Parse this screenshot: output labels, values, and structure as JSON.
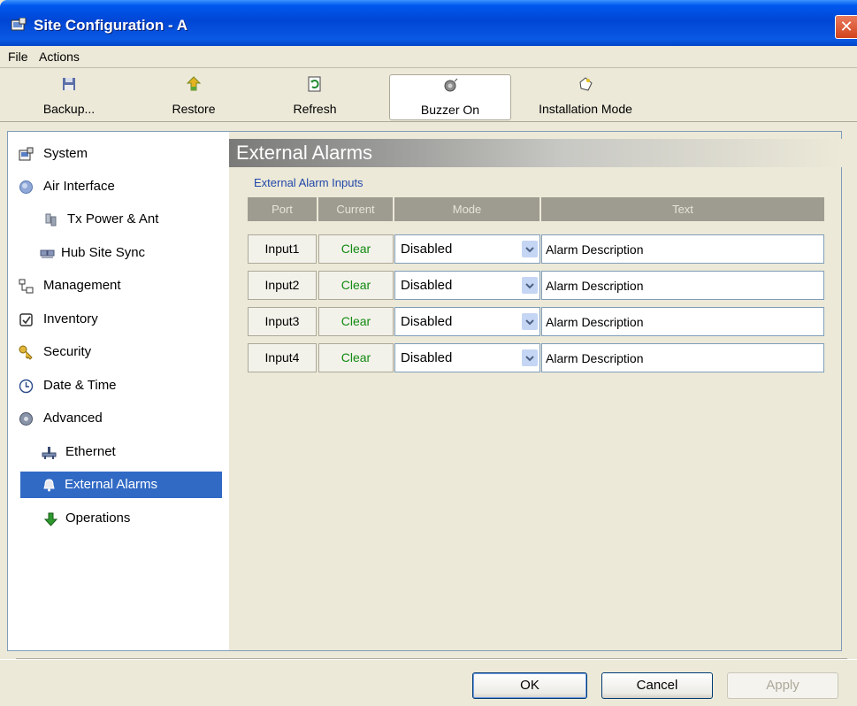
{
  "window": {
    "title": "Site Configuration - A",
    "close_label": "✕"
  },
  "menu": {
    "items": [
      {
        "label": "File"
      },
      {
        "label": "Actions"
      }
    ]
  },
  "toolbar": {
    "backup": {
      "label": "Backup...",
      "icon": "save-icon"
    },
    "restore": {
      "label": "Restore",
      "icon": "restore-icon"
    },
    "refresh": {
      "label": "Refresh",
      "icon": "refresh-icon"
    },
    "buzzer": {
      "label": "Buzzer On",
      "icon": "buzzer-icon",
      "pressed": true
    },
    "installation": {
      "label": "Installation Mode",
      "icon": "installation-icon"
    }
  },
  "nav": {
    "items": [
      {
        "label": "System",
        "icon": "system-icon"
      },
      {
        "label": "Air Interface",
        "icon": "air-interface-icon"
      },
      {
        "label": "Tx Power & Ant",
        "icon": "antenna-icon"
      },
      {
        "label": "Hub Site Sync",
        "icon": "sync-icon"
      },
      {
        "label": "Management",
        "icon": "management-icon"
      },
      {
        "label": "Inventory",
        "icon": "inventory-icon"
      },
      {
        "label": "Security",
        "icon": "security-icon"
      },
      {
        "label": "Date & Time",
        "icon": "clock-icon"
      },
      {
        "label": "Advanced",
        "icon": "advanced-icon"
      },
      {
        "label": "Ethernet",
        "icon": "ethernet-icon"
      },
      {
        "label": "External Alarms",
        "icon": "alarm-icon",
        "selected": true
      },
      {
        "label": "Operations",
        "icon": "operations-icon"
      }
    ]
  },
  "main": {
    "title": "External Alarms",
    "subtitle": "External Alarm Inputs",
    "columns": [
      "Port",
      "Current",
      "Mode",
      "Text"
    ],
    "rows": [
      {
        "port": "Input1",
        "current": "Clear",
        "mode": "Disabled",
        "text": "Alarm Description"
      },
      {
        "port": "Input2",
        "current": "Clear",
        "mode": "Disabled",
        "text": "Alarm Description"
      },
      {
        "port": "Input3",
        "current": "Clear",
        "mode": "Disabled",
        "text": "Alarm Description"
      },
      {
        "port": "Input4",
        "current": "Clear",
        "mode": "Disabled",
        "text": "Alarm Description"
      }
    ]
  },
  "buttons": {
    "ok": "OK",
    "cancel": "Cancel",
    "apply": "Apply"
  },
  "colors": {
    "titlebar": "#0054E3",
    "selection": "#316AC5",
    "clear_status": "#128A12",
    "link": "#2147A9"
  }
}
